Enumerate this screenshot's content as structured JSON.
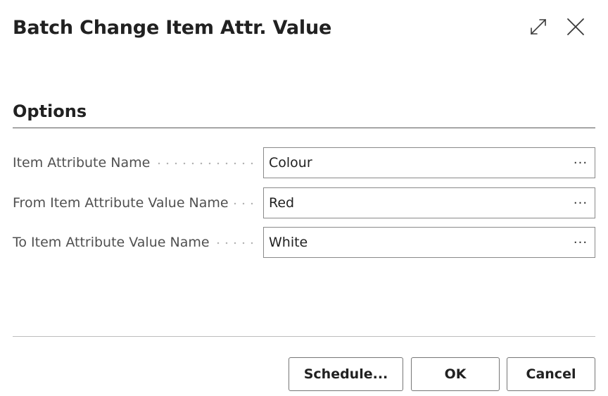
{
  "dialog": {
    "title": "Batch Change Item Attr. Value",
    "expand_icon": "expand-icon",
    "close_icon": "close-icon"
  },
  "options": {
    "section_title": "Options",
    "fields": [
      {
        "label": "Item Attribute Name",
        "value": "Colour",
        "lookup_label": "···"
      },
      {
        "label": "From Item Attribute Value Name",
        "value": "Red",
        "lookup_label": "···"
      },
      {
        "label": "To Item Attribute Value Name",
        "value": "White",
        "lookup_label": "···"
      }
    ]
  },
  "footer": {
    "schedule_label": "Schedule...",
    "ok_label": "OK",
    "cancel_label": "Cancel"
  },
  "colors": {
    "text": "#212121",
    "label": "#505050",
    "border": "#8a8a8a"
  }
}
